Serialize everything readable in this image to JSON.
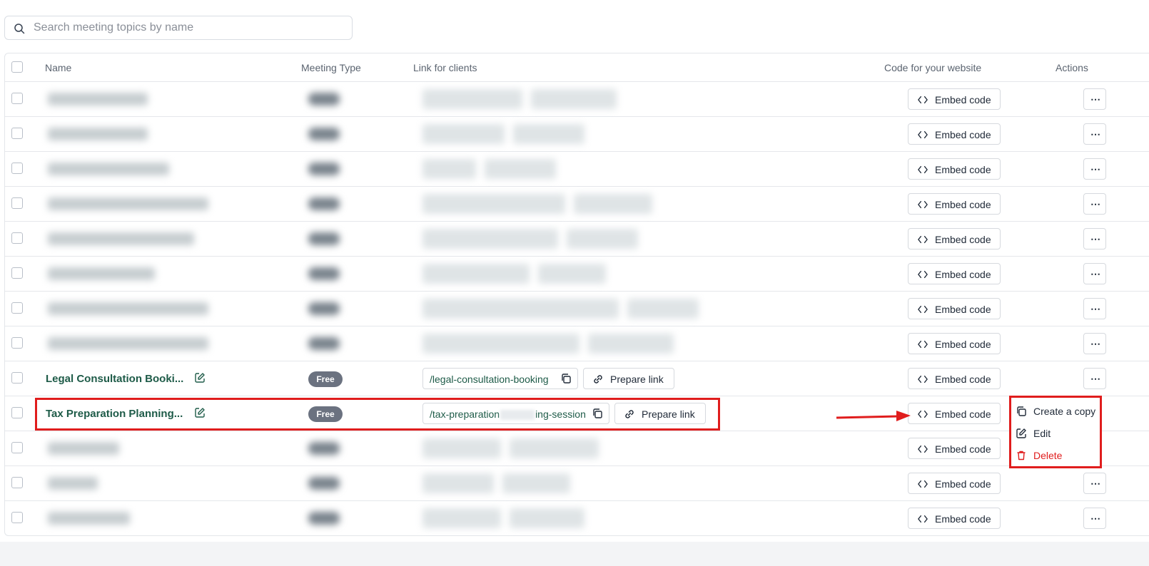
{
  "search": {
    "placeholder": "Search meeting topics by name"
  },
  "table": {
    "headers": {
      "name": "Name",
      "meeting_type": "Meeting Type",
      "link": "Link for clients",
      "code": "Code for your website",
      "actions": "Actions"
    },
    "embed_label": "Embed code",
    "prepare_label": "Prepare link",
    "rows": [
      {
        "name": "Legal Consultation Booki...",
        "type": "Free",
        "link": "/legal-consultation-booking"
      },
      {
        "name": "Tax Preparation Planning...",
        "type": "Free",
        "link_prefix": "/tax-preparation",
        "link_suffix": "ing-session"
      }
    ]
  },
  "menu": {
    "items": [
      {
        "label": "Create a copy",
        "icon": "copy-icon"
      },
      {
        "label": "Edit",
        "icon": "edit-icon"
      },
      {
        "label": "Delete",
        "icon": "trash-icon",
        "color": "#e01d1d"
      }
    ]
  },
  "colors": {
    "accent": "#1e5b48",
    "highlight": "#e01d1d",
    "badge": "#6b7280"
  }
}
